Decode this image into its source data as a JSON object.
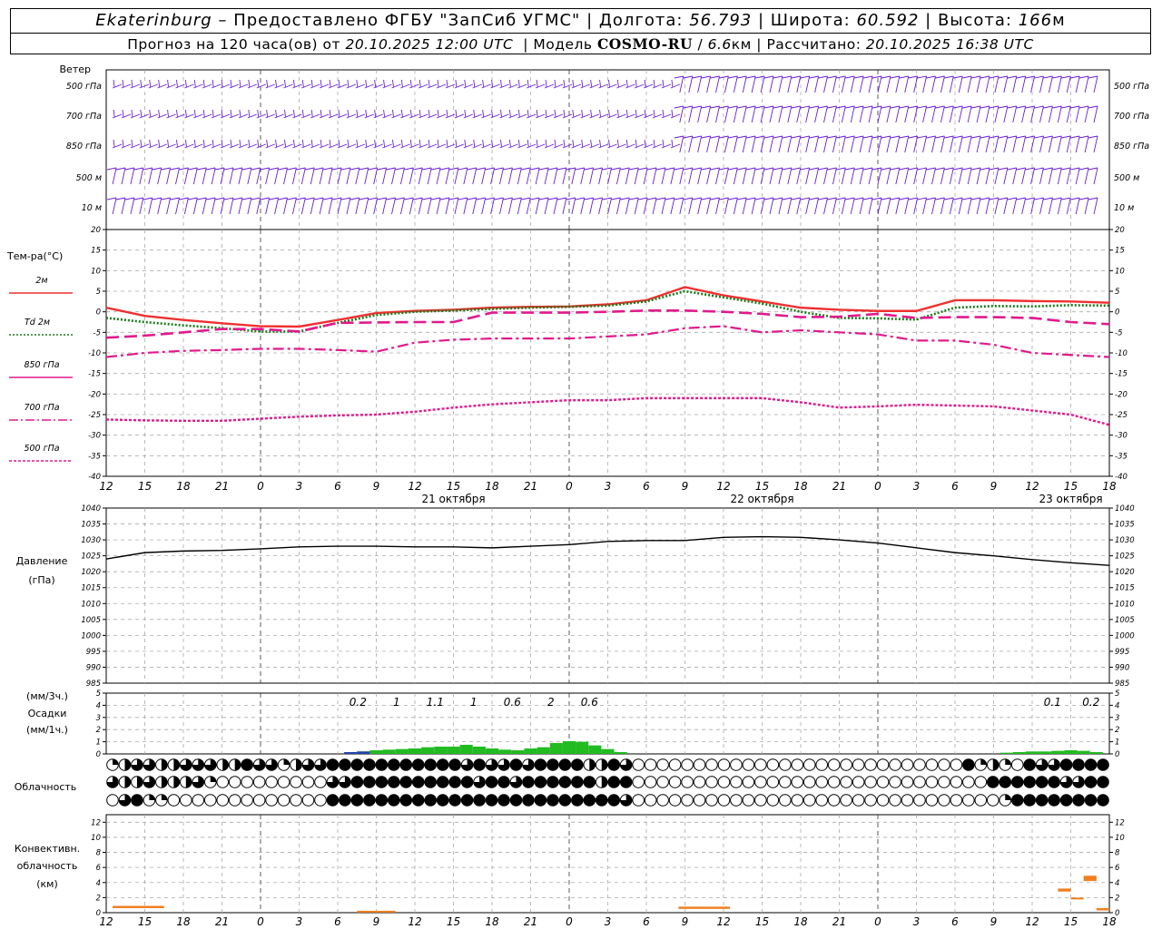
{
  "header": {
    "city": "Ekaterinburg",
    "provider": "– Предоставлено ФГБУ \"ЗапСиб УГМС\"",
    "lon_label": "Долгота:",
    "lon_value": "56.793",
    "lat_label": "Широта:",
    "lat_value": "60.592",
    "alt_label": "Высота:",
    "alt_value": "166",
    "alt_unit": "м",
    "forecast_prefix": "Прогноз на 120 часа(ов) от",
    "forecast_time": "20.10.2025 12:00 UTC",
    "model_label": "Модель",
    "model_name": "COSMO-RU",
    "model_res": "6.6",
    "model_res_unit": "км",
    "calc_label": "Рассчитано:",
    "calc_time": "20.10.2025 16:38 UTC"
  },
  "labels": {
    "wind_title": "Ветер",
    "wind_levels": [
      "500 гПа",
      "700 гПа",
      "850 гПа",
      "500 м",
      "10 м"
    ],
    "temp_title": "Тем-ра(°С)",
    "temp_legend": [
      "2м",
      "Td 2м",
      "850 гПа",
      "700 гПа",
      "500 гПа"
    ],
    "pressure_title": "Давление",
    "pressure_unit": "(гПа)",
    "precip_unit_3h": "(мм/3ч.)",
    "precip_title": "Осадки",
    "precip_unit_1h": "(мм/1ч.)",
    "cloud_title": "Облачность",
    "conv_title_1": "Конвективн.",
    "conv_title_2": "облачность",
    "conv_unit": "(км)",
    "hour_ticks": [
      "12",
      "15",
      "18",
      "21",
      "0",
      "3",
      "6",
      "9",
      "12",
      "15",
      "18",
      "21",
      "0",
      "3",
      "6",
      "9",
      "12",
      "15",
      "18",
      "21",
      "0",
      "3",
      "6",
      "9",
      "12",
      "15",
      "18"
    ],
    "day_labels": [
      "21 октября",
      "22 октября",
      "23 октября"
    ]
  },
  "colors": {
    "wind": "#6a1fd0",
    "t2m": "#ee3030",
    "td2m": "#1a7a1a",
    "t850": "#e01a8c",
    "t700": "#e01a8c",
    "t500": "#e01a8c",
    "precip": "#22bb22",
    "precip_conv": "#2244aa",
    "conv_cloud": "#f07f20"
  },
  "chart_data": [
    {
      "type": "line",
      "name": "temperature",
      "x_hours_from_start": [
        0,
        3,
        6,
        9,
        12,
        15,
        18,
        21,
        24,
        27,
        30,
        33,
        36,
        39,
        42,
        45,
        48,
        51,
        54,
        57,
        60,
        63,
        66,
        69,
        72,
        75,
        78
      ],
      "x_ticks": [
        "12",
        "15",
        "18",
        "21",
        "0",
        "3",
        "6",
        "9",
        "12",
        "15",
        "18",
        "21",
        "0",
        "3",
        "6",
        "9",
        "12",
        "15",
        "18",
        "21",
        "0",
        "3",
        "6",
        "9",
        "12",
        "15",
        "18"
      ],
      "ylim": [
        -40,
        20
      ],
      "yticks": [
        -40,
        -35,
        -30,
        -25,
        -20,
        -15,
        -10,
        -5,
        0,
        5,
        10,
        15,
        20
      ],
      "series": [
        {
          "name": "2м",
          "values": [
            1,
            -1,
            -2,
            -2.8,
            -3.5,
            -3.6,
            -2,
            -0.3,
            0.2,
            0.5,
            1,
            1.2,
            1.3,
            1.8,
            2.8,
            6,
            4,
            2.5,
            1,
            0.5,
            0.2,
            0.2,
            2.8,
            2.8,
            2.6,
            2.5,
            2.2
          ]
        },
        {
          "name": "Td 2м",
          "values": [
            -1.5,
            -2.5,
            -3.3,
            -4,
            -4.8,
            -4.8,
            -2.7,
            -0.8,
            0,
            0.3,
            0.7,
            1,
            1.2,
            1.5,
            2.5,
            5,
            3.5,
            2,
            0,
            -1.5,
            -1.6,
            -1.9,
            1,
            1.4,
            1.3,
            1.6,
            1.5
          ]
        },
        {
          "name": "850 гПа",
          "values": [
            -6.3,
            -5.8,
            -5,
            -4.2,
            -4.2,
            -4.8,
            -2.7,
            -2.6,
            -2.5,
            -2.5,
            -0.2,
            -0.2,
            -0.2,
            0,
            0.3,
            0.3,
            0,
            -0.5,
            -1.3,
            -1.2,
            -0.5,
            -1.5,
            -1.3,
            -1.3,
            -1.5,
            -2.5,
            -3
          ]
        },
        {
          "name": "700 гПа",
          "values": [
            -11,
            -10,
            -9.5,
            -9.3,
            -9,
            -9,
            -9.3,
            -9.7,
            -7.5,
            -6.8,
            -6.5,
            -6.5,
            -6.5,
            -6,
            -5.5,
            -4,
            -3.5,
            -5,
            -4.5,
            -5,
            -5.5,
            -7,
            -7,
            -8,
            -10,
            -10.5,
            -11
          ]
        },
        {
          "name": "500 гПа",
          "values": [
            -26.2,
            -26.4,
            -26.5,
            -26.5,
            -26,
            -25.5,
            -25.2,
            -25,
            -24.3,
            -23.3,
            -22.5,
            -22,
            -21.5,
            -21.5,
            -21,
            -21,
            -21,
            -21,
            -22,
            -23.3,
            -23,
            -22.6,
            -22.8,
            -23,
            -24,
            -25,
            -27.5
          ]
        }
      ]
    },
    {
      "type": "line",
      "name": "pressure",
      "x_hours_from_start": [
        0,
        3,
        6,
        9,
        12,
        15,
        18,
        21,
        24,
        27,
        30,
        33,
        36,
        39,
        42,
        45,
        48,
        51,
        54,
        57,
        60,
        63,
        66,
        69,
        72,
        75,
        78
      ],
      "ylim": [
        985,
        1040
      ],
      "yticks": [
        985,
        990,
        995,
        1000,
        1005,
        1010,
        1015,
        1020,
        1025,
        1030,
        1035,
        1040
      ],
      "series": [
        {
          "name": "Давление",
          "values": [
            1024,
            1026,
            1026.5,
            1026.7,
            1027.2,
            1027.8,
            1028,
            1028,
            1027.8,
            1027.8,
            1027.5,
            1028,
            1028.5,
            1029.5,
            1029.8,
            1029.8,
            1030.8,
            1031,
            1030.8,
            1030,
            1029,
            1027.5,
            1026,
            1025,
            1023.8,
            1022.8,
            1022
          ]
        }
      ]
    },
    {
      "type": "bar",
      "name": "precipitation",
      "x_hours_from_start": [
        19,
        20,
        21,
        22,
        23,
        24,
        25,
        26,
        27,
        28,
        29,
        30,
        31,
        32,
        33,
        34,
        35,
        36,
        37,
        38,
        39,
        40,
        70,
        71,
        72,
        73,
        74,
        75,
        76,
        77
      ],
      "ylim": [
        0,
        5
      ],
      "yticks": [
        0,
        1,
        2,
        3,
        4,
        5
      ],
      "values": [
        0.05,
        0.2,
        0.3,
        0.35,
        0.4,
        0.45,
        0.55,
        0.6,
        0.6,
        0.75,
        0.6,
        0.45,
        0.35,
        0.3,
        0.45,
        0.55,
        0.9,
        1.05,
        1.0,
        0.7,
        0.4,
        0.15,
        0.1,
        0.15,
        0.2,
        0.2,
        0.25,
        0.3,
        0.25,
        0.15
      ],
      "convective_x_hours_from_start": [
        19,
        20
      ],
      "convective_values": [
        0.15,
        0.2
      ],
      "totals_3h": [
        {
          "x_hour": 20,
          "label": "0.2"
        },
        {
          "x_hour": 23,
          "label": "1"
        },
        {
          "x_hour": 26,
          "label": "1.1"
        },
        {
          "x_hour": 29,
          "label": "1"
        },
        {
          "x_hour": 32,
          "label": "0.6"
        },
        {
          "x_hour": 35,
          "label": "2"
        },
        {
          "x_hour": 38,
          "label": "0.6"
        },
        {
          "x_hour": 74,
          "label": "0.1"
        },
        {
          "x_hour": 77,
          "label": "0.2"
        }
      ]
    },
    {
      "type": "table",
      "name": "cloudiness_octas",
      "rows": [
        {
          "name": "верхняя",
          "values": [
            2,
            4,
            6,
            6,
            4,
            4,
            6,
            6,
            6,
            4,
            4,
            8,
            6,
            6,
            2,
            4,
            6,
            6,
            8,
            8,
            8,
            8,
            8,
            8,
            8,
            8,
            8,
            8,
            8,
            6,
            8,
            6,
            6,
            8,
            6,
            8,
            8,
            8,
            8,
            4,
            4,
            8,
            6,
            0,
            0,
            0,
            0,
            0,
            0,
            0,
            0,
            0,
            0,
            0,
            0,
            0,
            0,
            0,
            0,
            0,
            0,
            0,
            0,
            0,
            0,
            0,
            0,
            0,
            0,
            0,
            8,
            2,
            4,
            2,
            0,
            8,
            6,
            6,
            8,
            8,
            8,
            8
          ]
        },
        {
          "name": "средняя",
          "values": [
            6,
            4,
            4,
            6,
            4,
            4,
            4,
            6,
            2,
            0,
            0,
            0,
            0,
            0,
            0,
            0,
            0,
            0,
            6,
            6,
            8,
            8,
            8,
            8,
            8,
            8,
            8,
            8,
            8,
            8,
            6,
            8,
            8,
            6,
            8,
            8,
            8,
            8,
            8,
            8,
            4,
            8,
            8,
            0,
            0,
            0,
            0,
            0,
            0,
            0,
            0,
            0,
            0,
            0,
            0,
            0,
            0,
            0,
            0,
            0,
            0,
            0,
            0,
            0,
            0,
            0,
            0,
            0,
            0,
            0,
            0,
            0,
            8,
            8,
            8,
            8,
            8,
            8,
            6,
            6,
            8,
            8
          ]
        },
        {
          "name": "нижняя",
          "values": [
            0,
            6,
            8,
            2,
            2,
            0,
            0,
            0,
            0,
            0,
            0,
            0,
            0,
            0,
            0,
            0,
            0,
            0,
            8,
            8,
            8,
            8,
            8,
            8,
            8,
            8,
            8,
            8,
            8,
            8,
            8,
            8,
            8,
            8,
            8,
            8,
            8,
            8,
            8,
            8,
            8,
            8,
            6,
            0,
            0,
            0,
            0,
            0,
            0,
            0,
            0,
            0,
            0,
            0,
            0,
            0,
            0,
            0,
            0,
            0,
            0,
            0,
            0,
            0,
            0,
            0,
            0,
            0,
            0,
            0,
            0,
            0,
            0,
            2,
            8,
            8,
            8,
            8,
            8,
            8,
            8,
            8
          ]
        }
      ]
    },
    {
      "type": "bar",
      "name": "convective_cloud",
      "ylim": [
        0,
        13
      ],
      "yticks": [
        0,
        2,
        4,
        6,
        8,
        10,
        12
      ],
      "segments": [
        {
          "x_start_hour": 0.5,
          "x_end_hour": 4.5,
          "bottom": 0.6,
          "top": 0.9
        },
        {
          "x_start_hour": 19.5,
          "x_end_hour": 22.5,
          "bottom": 0.1,
          "top": 0.25
        },
        {
          "x_start_hour": 44.5,
          "x_end_hour": 48.5,
          "bottom": 0.5,
          "top": 0.8
        },
        {
          "x_start_hour": 74,
          "x_end_hour": 75,
          "bottom": 2.8,
          "top": 3.2
        },
        {
          "x_start_hour": 75,
          "x_end_hour": 76,
          "bottom": 1.8,
          "top": 2.0
        },
        {
          "x_start_hour": 76,
          "x_end_hour": 77,
          "bottom": 4.2,
          "top": 4.9
        },
        {
          "x_start_hour": 77,
          "x_end_hour": 78,
          "bottom": 0.3,
          "top": 0.6
        }
      ]
    }
  ]
}
